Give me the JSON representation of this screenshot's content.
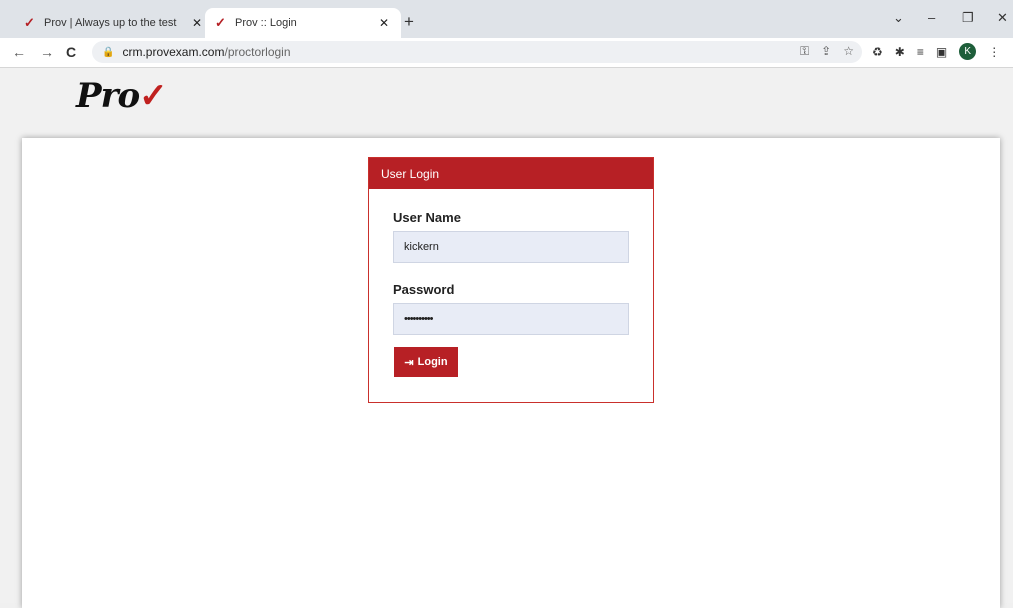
{
  "browser": {
    "tabs": [
      {
        "title": "Prov | Always up to the test",
        "favicon": "check-icon"
      },
      {
        "title": "Prov :: Login",
        "favicon": "check-icon"
      }
    ],
    "url_host": "crm.provexam.com",
    "url_path": "/proctorlogin",
    "avatar_letter": "K"
  },
  "logo": {
    "text": "Pro",
    "mark": "✓"
  },
  "login": {
    "header": "User Login",
    "username_label": "User Name",
    "username_value": "kickern",
    "password_label": "Password",
    "password_value": "••••••••••",
    "button_label": "Login",
    "button_icon": "sign-in-icon"
  },
  "colors": {
    "brand_red": "#b72025",
    "field_bg": "#e8ecf6"
  }
}
